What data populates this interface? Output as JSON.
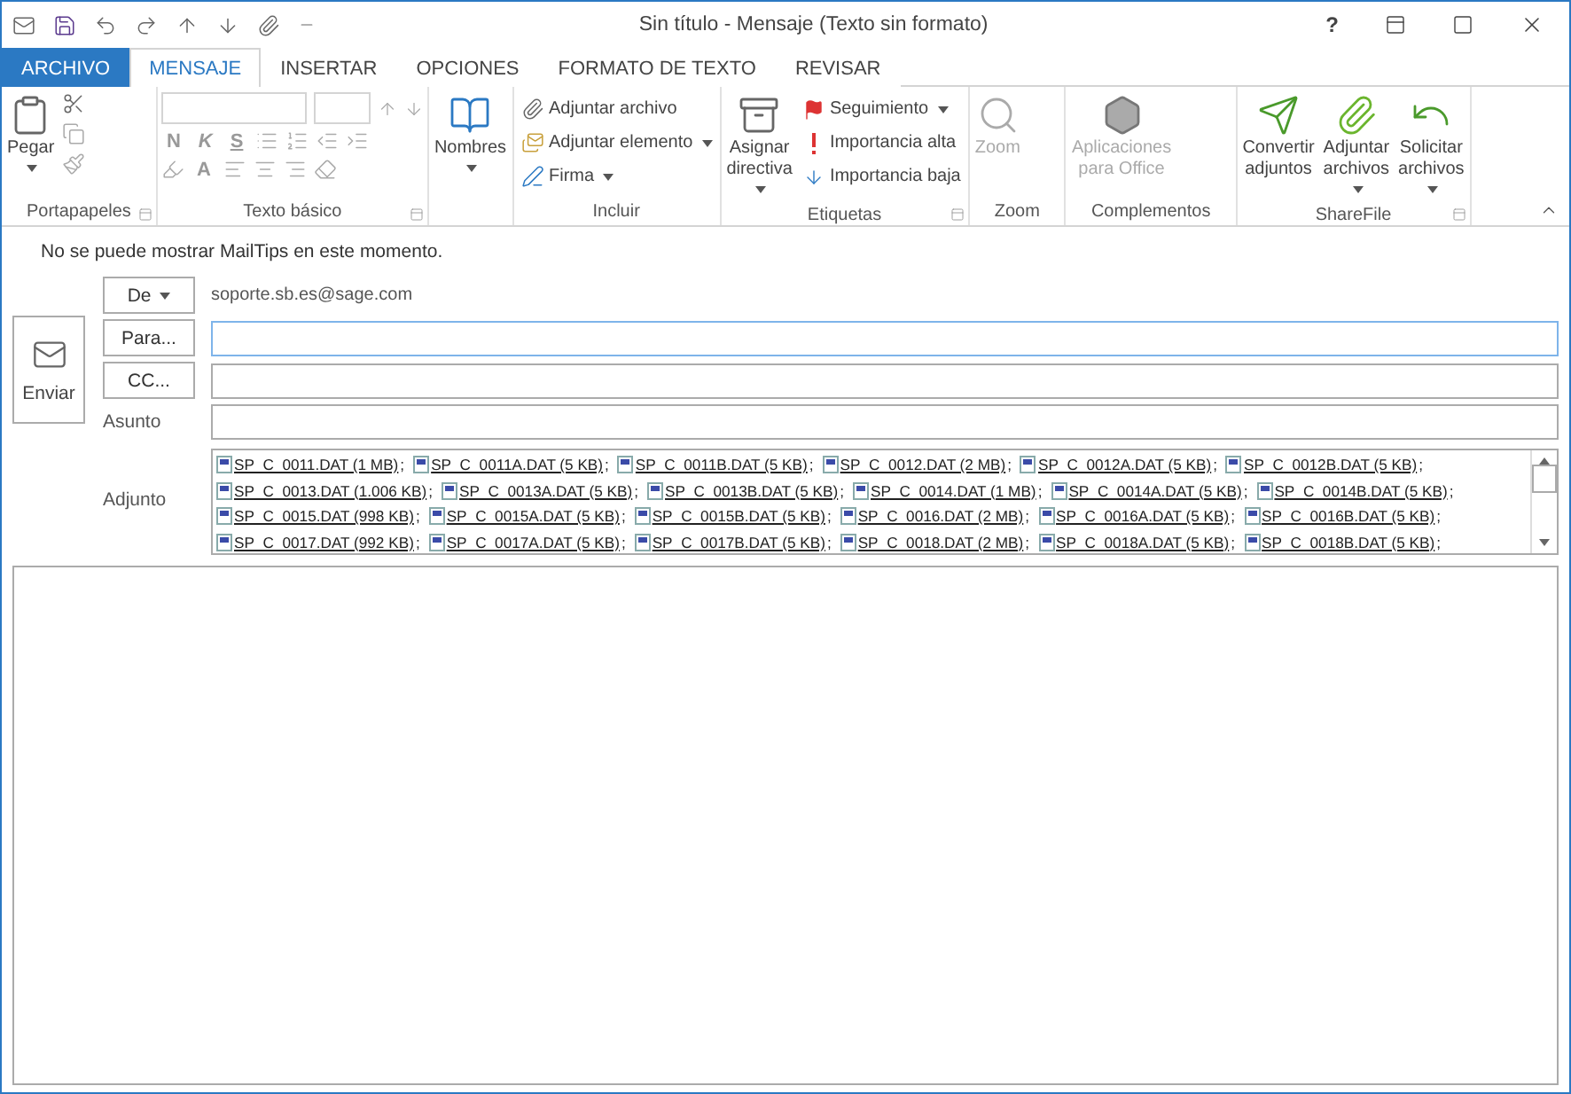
{
  "window": {
    "title": "Sin título - Mensaje (Texto sin formato)",
    "help": "?"
  },
  "tabs": [
    {
      "label": "ARCHIVO",
      "kind": "file",
      "selected": false
    },
    {
      "label": "MENSAJE",
      "kind": "tab",
      "selected": true
    },
    {
      "label": "INSERTAR",
      "kind": "tab",
      "selected": false
    },
    {
      "label": "OPCIONES",
      "kind": "tab",
      "selected": false
    },
    {
      "label": "FORMATO DE TEXTO",
      "kind": "tab",
      "selected": false
    },
    {
      "label": "REVISAR",
      "kind": "tab",
      "selected": false
    }
  ],
  "ribbon": [
    {
      "kind": "clipboard",
      "label": "Portapapeles",
      "launcher": true,
      "items": [
        {
          "label": "Pegar",
          "dropdown": true,
          "disabled": false
        }
      ]
    },
    {
      "kind": "font",
      "label": "Texto básico",
      "launcher": true,
      "items": [
        {
          "label": "N",
          "disabled": true
        },
        {
          "label": "K",
          "disabled": true
        },
        {
          "label": "S",
          "disabled": true
        },
        {
          "label": "A",
          "disabled": true
        }
      ]
    },
    {
      "kind": "large",
      "launcher": false,
      "items": [
        {
          "label": "Nombres",
          "dropdown": true,
          "disabled": false
        }
      ]
    },
    {
      "kind": "small",
      "label": "Incluir",
      "launcher": false,
      "items": [
        {
          "label": "Adjuntar archivo",
          "dropdown": false,
          "disabled": false
        },
        {
          "label": "Adjuntar elemento",
          "dropdown": true,
          "disabled": false
        },
        {
          "label": "Firma",
          "dropdown": true,
          "disabled": false
        }
      ]
    },
    {
      "kind": "tags",
      "label": "Etiquetas",
      "launcher": true,
      "items": [
        {
          "label": "Asignar\ndirectiva",
          "dropdown": true,
          "disabled": false
        },
        {
          "label": "Seguimiento",
          "dropdown": true,
          "disabled": false
        },
        {
          "label": "Importancia alta",
          "dropdown": false,
          "disabled": false
        },
        {
          "label": "Importancia baja",
          "dropdown": false,
          "disabled": false
        }
      ]
    },
    {
      "kind": "zoom",
      "label": "Zoom",
      "launcher": false,
      "items": [
        {
          "label": "Zoom",
          "dropdown": false,
          "disabled": true
        }
      ]
    },
    {
      "kind": "addins",
      "label": "Complementos",
      "launcher": false,
      "items": [
        {
          "label": "Aplicaciones\npara Office",
          "dropdown": false,
          "disabled": true
        }
      ]
    },
    {
      "kind": "sharefile",
      "label": "ShareFile",
      "launcher": true,
      "items": [
        {
          "label": "Convertir\nadjuntos",
          "dropdown": false,
          "disabled": false
        },
        {
          "label": "Adjuntar\narchivos",
          "dropdown": true,
          "disabled": false
        },
        {
          "label": "Solicitar\narchivos",
          "dropdown": true,
          "disabled": false
        }
      ]
    }
  ],
  "mailtips": "No se puede mostrar MailTips en este momento.",
  "send": "Enviar",
  "from": {
    "button": "De",
    "value": "soporte.sb.es@sage.com"
  },
  "to": {
    "button": "Para..."
  },
  "cc": {
    "button": "CC..."
  },
  "subject": {
    "label": "Asunto"
  },
  "attachments_label": "Adjunto",
  "attachments": [
    "SP_C_0011.DAT (1 MB)",
    "SP_C_0011A.DAT (5 KB)",
    "SP_C_0011B.DAT (5 KB)",
    "SP_C_0012.DAT (2 MB)",
    "SP_C_0012A.DAT (5 KB)",
    "SP_C_0012B.DAT (5 KB)",
    "SP_C_0013.DAT (1.006 KB)",
    "SP_C_0013A.DAT (5 KB)",
    "SP_C_0013B.DAT (5 KB)",
    "SP_C_0014.DAT (1 MB)",
    "SP_C_0014A.DAT (5 KB)",
    "SP_C_0014B.DAT (5 KB)",
    "SP_C_0015.DAT (998 KB)",
    "SP_C_0015A.DAT (5 KB)",
    "SP_C_0015B.DAT (5 KB)",
    "SP_C_0016.DAT (2 MB)",
    "SP_C_0016A.DAT (5 KB)",
    "SP_C_0016B.DAT (5 KB)",
    "SP_C_0017.DAT (992 KB)",
    "SP_C_0017A.DAT (5 KB)",
    "SP_C_0017B.DAT (5 KB)",
    "SP_C_0018.DAT (2 MB)",
    "SP_C_0018A.DAT (5 KB)",
    "SP_C_0018B.DAT (5 KB)"
  ],
  "separator": ";"
}
